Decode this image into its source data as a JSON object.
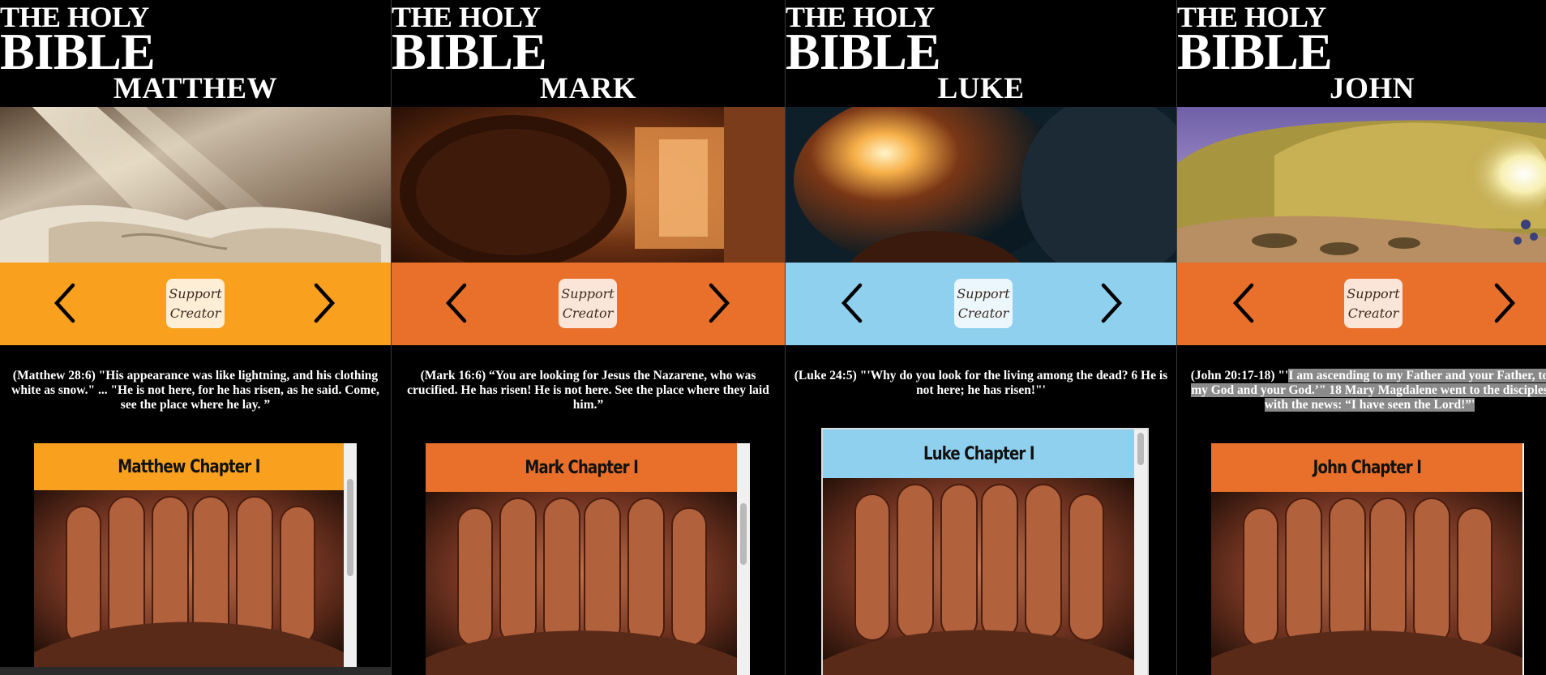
{
  "logo": {
    "line1": "THE HOLY",
    "line2": "BIBLE"
  },
  "colors": {
    "orange": "#f9a11f",
    "dark_orange": "#e8702b",
    "sky_blue": "#8fd0ef",
    "background": "#000000"
  },
  "icons": {
    "prev": "chevron-left-icon",
    "next": "chevron-right-icon"
  },
  "panels": [
    {
      "book": "MATTHEW",
      "nav_color": "#f9a11f",
      "support_line1": "Support",
      "support_line2": "Creator",
      "verse": "(Matthew 28:6) \"His appearance was like lightning, and his clothing white as snow.\" ... \"He is not here, for he has risen, as he said. Come, see the place where he lay. ”",
      "chapter_label": "Matthew Chapter I"
    },
    {
      "book": "MARK",
      "nav_color": "#e8702b",
      "support_line1": "Support",
      "support_line2": "Creator",
      "verse": "(Mark 16:6) “You are looking for Jesus the Nazarene, who was crucified. He has risen! He is not here. See the place where they laid him.”",
      "chapter_label": "Mark Chapter I"
    },
    {
      "book": "LUKE",
      "nav_color": "#8fd0ef",
      "support_line1": "Support",
      "support_line2": "Creator",
      "verse": "(Luke 24:5) \"'Why do you look for the living among the dead? 6 He is not here; he has risen!\"'",
      "chapter_label": "Luke Chapter I"
    },
    {
      "book": "JOHN",
      "nav_color": "#e8702b",
      "support_line1": "Support",
      "support_line2": "Creator",
      "verse_prefix": "(John 20:17-18) \"'",
      "verse_highlight": "I am ascending to my Father and your Father, to my God and your God.’\" 18 Mary Magdalene went to the disciples with the news: “I have seen the Lord!”'",
      "chapter_label": "John Chapter I"
    }
  ]
}
